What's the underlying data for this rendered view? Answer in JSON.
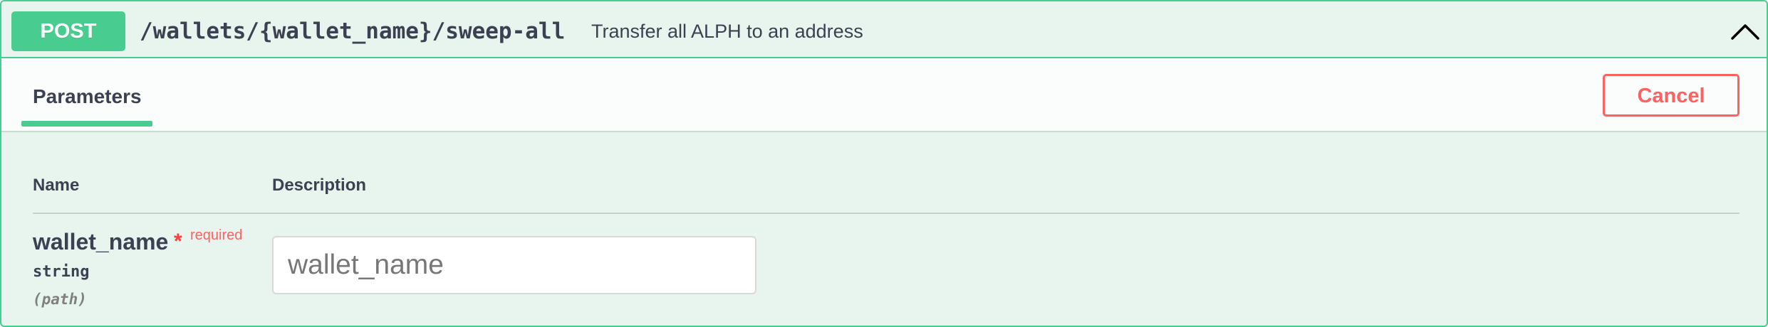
{
  "operation": {
    "method": "POST",
    "path": "/wallets/{wallet_name}/sweep-all",
    "description": "Transfer all ALPH to an address",
    "collapse_icon": "chevron-up-icon",
    "accent_color": "#49cc90",
    "background_color": "#e8f4ee"
  },
  "tabs": {
    "parameters_label": "Parameters",
    "cancel_label": "Cancel",
    "cancel_color": "#ff6060"
  },
  "table": {
    "name_header": "Name",
    "description_header": "Description"
  },
  "parameters": [
    {
      "name": "wallet_name",
      "required_star": "*",
      "required_label": "required",
      "type": "string",
      "location": "(path)",
      "value": "",
      "placeholder": "wallet_name"
    }
  ]
}
